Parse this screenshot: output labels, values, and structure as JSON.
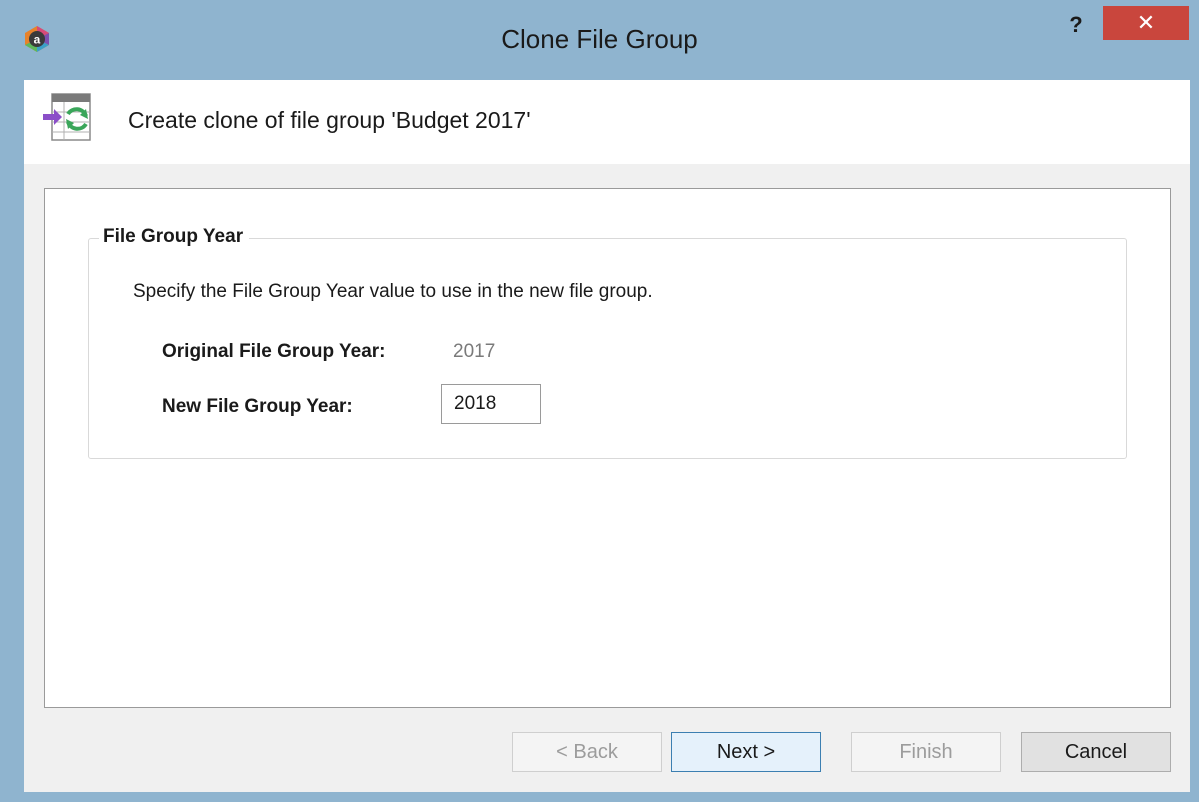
{
  "window": {
    "title": "Clone File Group",
    "help_label": "?",
    "close_label": "✕"
  },
  "header": {
    "text": "Create clone of file group 'Budget 2017'"
  },
  "group": {
    "legend": "File Group Year",
    "description": "Specify the File Group Year value to use in the new file group.",
    "original_label": "Original File Group Year:",
    "original_value": "2017",
    "new_label": "New File Group Year:",
    "new_value": "2018"
  },
  "buttons": {
    "back": "< Back",
    "next": "Next >",
    "finish": "Finish",
    "cancel": "Cancel"
  },
  "colors": {
    "titlebar": "#8fb4cf",
    "close": "#c9463d",
    "primary_border": "#3c7fb1"
  }
}
